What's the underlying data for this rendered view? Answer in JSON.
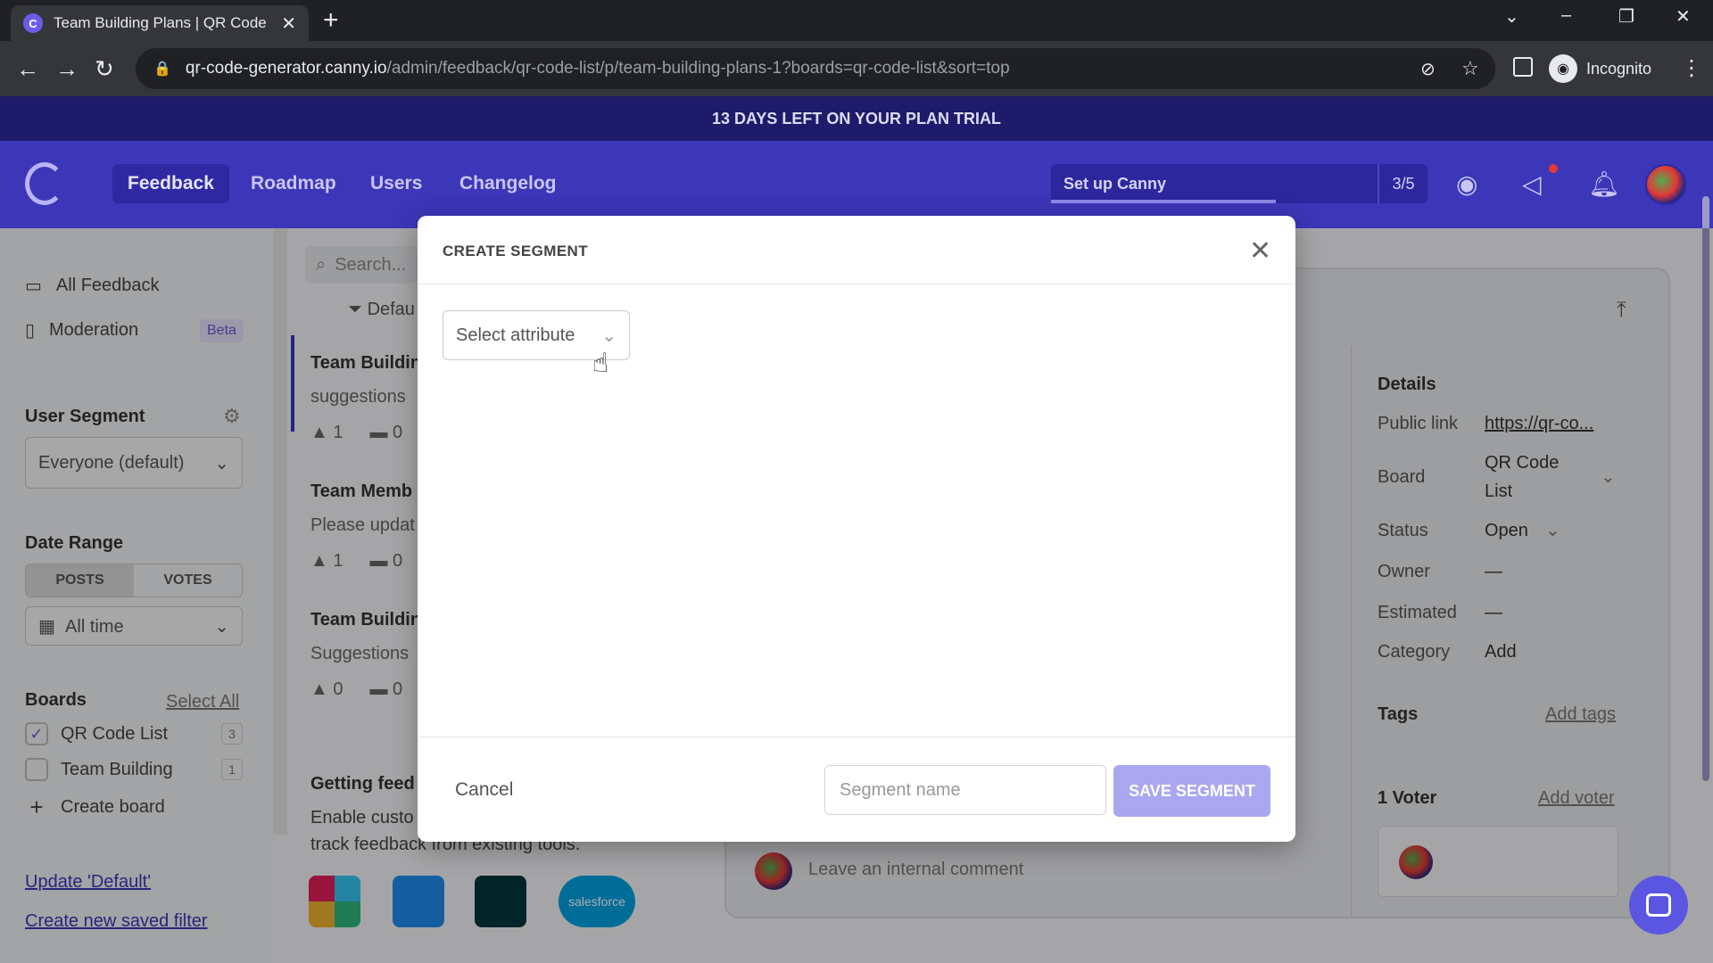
{
  "browser": {
    "tab_title": "Team Building Plans | QR Code L",
    "url_host": "qr-code-generator.canny.io",
    "url_path": "/admin/feedback/qr-code-list/p/team-building-plans-1?boards=qr-code-list&sort=top",
    "profile_label": "Incognito"
  },
  "banner": {
    "trial_text": "13 DAYS LEFT ON YOUR PLAN TRIAL"
  },
  "nav": {
    "items": [
      "Feedback",
      "Roadmap",
      "Users",
      "Changelog"
    ],
    "setup_label": "Set up Canny",
    "setup_progress": "3/5"
  },
  "sidebar": {
    "all_feedback": "All Feedback",
    "moderation": "Moderation",
    "beta": "Beta",
    "user_segment_heading": "User Segment",
    "user_segment_value": "Everyone (default)",
    "date_range_heading": "Date Range",
    "posts_tab": "POSTS",
    "votes_tab": "VOTES",
    "date_value": "All time",
    "boards_heading": "Boards",
    "select_all": "Select All",
    "boards": [
      {
        "name": "QR Code List",
        "count": "3",
        "checked": true
      },
      {
        "name": "Team Building",
        "count": "1",
        "checked": false
      }
    ],
    "create_board": "Create board",
    "update_default": "Update 'Default'",
    "create_filter": "Create new saved filter"
  },
  "list": {
    "search_placeholder": "Search...",
    "filter_label": "Defau",
    "posts": [
      {
        "title": "Team Buildin",
        "desc": "suggestions",
        "votes": "1",
        "comments": "0"
      },
      {
        "title": "Team Memb",
        "desc": "Please updat",
        "votes": "1",
        "comments": "0"
      },
      {
        "title": "Team Buildin",
        "desc": "Suggestions",
        "votes": "0",
        "comments": "0"
      }
    ],
    "getting_title": "Getting feed",
    "getting_line1": "Enable custo",
    "getting_line2": "track feedback from existing tools."
  },
  "details": {
    "heading": "Details",
    "public_link_label": "Public link",
    "public_link_value": "https://qr-co...",
    "board_label": "Board",
    "board_value_1": "QR Code",
    "board_value_2": "List",
    "status_label": "Status",
    "status_value": "Open",
    "owner_label": "Owner",
    "owner_value": "—",
    "estimated_label": "Estimated",
    "estimated_value": "—",
    "category_label": "Category",
    "category_value": "Add",
    "tags_label": "Tags",
    "add_tags": "Add tags",
    "voters_label": "1 Voter",
    "add_voter": "Add voter",
    "comment_placeholder": "Leave an internal comment"
  },
  "modal": {
    "title": "CREATE SEGMENT",
    "attribute_placeholder": "Select attribute",
    "cancel": "Cancel",
    "segment_name_placeholder": "Segment name",
    "save": "SAVE SEGMENT"
  },
  "integrations": {
    "salesforce": "salesforce"
  }
}
